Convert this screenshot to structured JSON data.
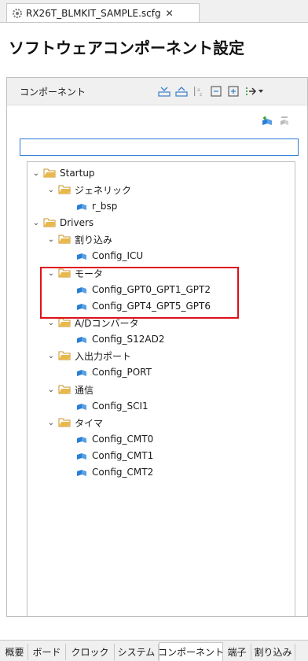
{
  "editor_tab": {
    "title": "RX26T_BLMKIT_SAMPLE.scfg",
    "close": "✕"
  },
  "page_title": "ソフトウェアコンポーネント設定",
  "panel": {
    "label": "コンポーネント"
  },
  "search": {
    "value": "",
    "placeholder": ""
  },
  "tree": {
    "startup": "Startup",
    "generic": "ジェネリック",
    "r_bsp": "r_bsp",
    "drivers": "Drivers",
    "interrupt": "割り込み",
    "config_icu": "Config_ICU",
    "motor": "モータ",
    "config_gpt0": "Config_GPT0_GPT1_GPT2",
    "config_gpt4": "Config_GPT4_GPT5_GPT6",
    "adc": "A/Dコンバータ",
    "config_s12ad2": "Config_S12AD2",
    "io_port": "入出力ポート",
    "config_port": "Config_PORT",
    "comm": "通信",
    "config_sci1": "Config_SCI1",
    "timer": "タイマ",
    "config_cmt0": "Config_CMT0",
    "config_cmt1": "Config_CMT1",
    "config_cmt2": "Config_CMT2"
  },
  "bottom_tabs": {
    "overview": "概要",
    "board": "ボード",
    "clock": "クロック",
    "system": "システム",
    "components": "コンポーネント",
    "pins": "端子",
    "interrupts": "割り込み"
  },
  "colors": {
    "folder": "#e8b84a",
    "component": "#2a7fd4",
    "highlight": "#e0101a",
    "search_border": "#2e7dd2"
  }
}
